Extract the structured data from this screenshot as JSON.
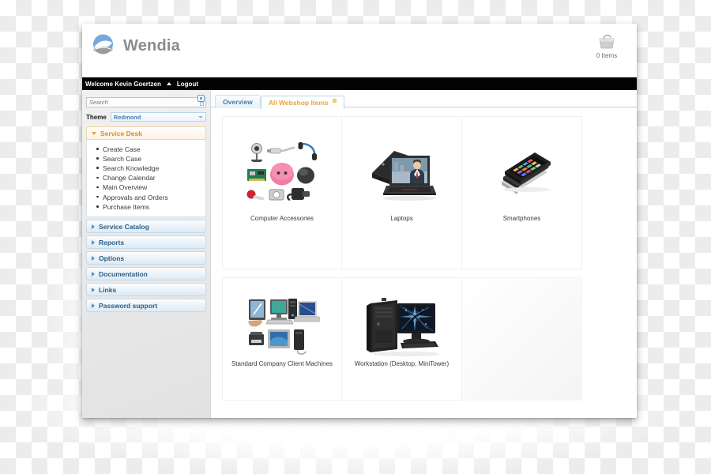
{
  "app": {
    "brand": "Wendia",
    "cart_items_label": "0 Items",
    "welcome_text": "Welcome Kevin Goertzen",
    "logout_label": "Logout"
  },
  "sidebar": {
    "search_placeholder": "Search",
    "search_value": "",
    "theme_label": "Theme",
    "theme_value": "Redmond",
    "panels": [
      {
        "label": "Service Desk",
        "expanded": true,
        "items": [
          "Create Case",
          "Search Case",
          "Search Knowledge",
          "Change Calendar",
          "Main Overview",
          "Approvals and Orders",
          "Purchase Items"
        ]
      },
      {
        "label": "Service Catalog",
        "expanded": false,
        "items": []
      },
      {
        "label": "Reports",
        "expanded": false,
        "items": []
      },
      {
        "label": "Options",
        "expanded": false,
        "items": []
      },
      {
        "label": "Documentation",
        "expanded": false,
        "items": []
      },
      {
        "label": "Links",
        "expanded": false,
        "items": []
      },
      {
        "label": "Password support",
        "expanded": false,
        "items": []
      }
    ]
  },
  "main": {
    "tabs": [
      {
        "label": "Overview",
        "active": false,
        "closable": false
      },
      {
        "label": "All Webshop Items",
        "active": true,
        "closable": true
      }
    ],
    "grid": {
      "row1": [
        {
          "label": "Computer Accessories",
          "art": "accessories"
        },
        {
          "label": "Laptops",
          "art": "laptop"
        },
        {
          "label": "Smartphones",
          "art": "smartphone"
        }
      ],
      "row2": [
        {
          "label": "Standard Company Client Machines",
          "art": "clients"
        },
        {
          "label": "Workstation (Desktop, MiniTower)",
          "art": "workstation"
        },
        {
          "label": "",
          "art": "none"
        }
      ]
    }
  },
  "colors": {
    "accent_orange": "#e08c1c",
    "accent_blue": "#2a5d86",
    "brand_gray": "#8b8b8b",
    "bar_black": "#030303"
  }
}
